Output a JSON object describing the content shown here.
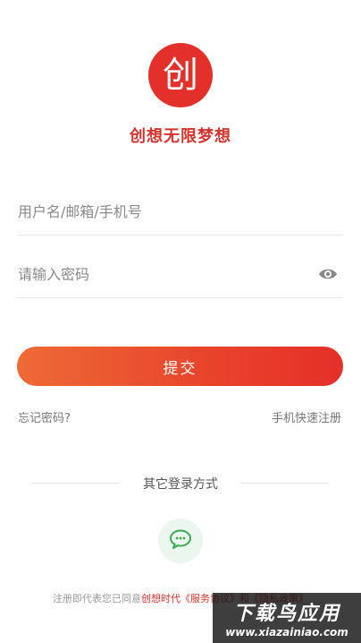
{
  "logo": {
    "glyph": "创",
    "color": "#e4302a"
  },
  "tagline": "创想无限梦想",
  "form": {
    "username_placeholder": "用户名/邮箱/手机号",
    "password_placeholder": "请输入密码",
    "submit_label": "提交",
    "submit_gradient": [
      "#ee6a36",
      "#e6302a"
    ]
  },
  "links": {
    "forgot_password": "忘记密码?",
    "quick_register": "手机快速注册"
  },
  "other_login": {
    "title": "其它登录方式",
    "icon": "wechat-icon"
  },
  "agreement": {
    "prefix": "注册即代表您已同意",
    "highlight": "创想时代《服务协议》和《隐私政策》"
  },
  "watermark": {
    "title": "下载鸟应用",
    "url": "www.xiazainiao.com"
  }
}
